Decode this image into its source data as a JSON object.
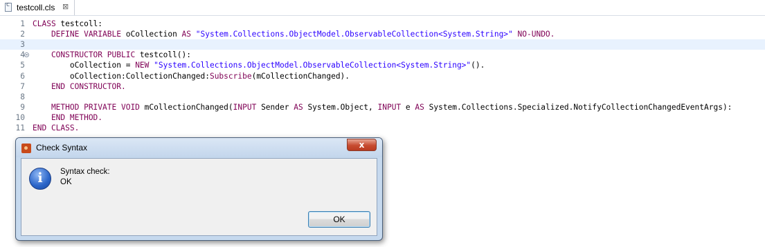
{
  "tab": {
    "filename": "testcoll.cls",
    "close_glyph": "⊠",
    "icon": "file-icon"
  },
  "editor": {
    "line_numbers": [
      "1",
      "2",
      "3",
      "4",
      "5",
      "6",
      "7",
      "8",
      "9",
      "10",
      "11"
    ],
    "lines": [
      [
        {
          "t": "CLASS ",
          "c": "kw"
        },
        {
          "t": "testcoll:",
          "c": ""
        }
      ],
      [
        {
          "t": "    DEFINE VARIABLE ",
          "c": "kw"
        },
        {
          "t": "oCollection ",
          "c": ""
        },
        {
          "t": "AS ",
          "c": "kw"
        },
        {
          "t": "\"System.Collections.ObjectModel.ObservableCollection<System.String>\"",
          "c": "str"
        },
        {
          "t": " NO-UNDO.",
          "c": "kw"
        }
      ],
      [],
      [
        {
          "t": "    CONSTRUCTOR PUBLIC ",
          "c": "kw"
        },
        {
          "t": "testcoll():",
          "c": ""
        }
      ],
      [
        {
          "t": "        oCollection = ",
          "c": ""
        },
        {
          "t": "NEW ",
          "c": "kw"
        },
        {
          "t": "\"System.Collections.ObjectModel.ObservableCollection<System.String>\"",
          "c": "str"
        },
        {
          "t": "().",
          "c": ""
        }
      ],
      [
        {
          "t": "        oCollection:CollectionChanged:",
          "c": ""
        },
        {
          "t": "Subscribe",
          "c": "kw"
        },
        {
          "t": "(mCollectionChanged).",
          "c": ""
        }
      ],
      [
        {
          "t": "    END CONSTRUCTOR.",
          "c": "kw"
        }
      ],
      [],
      [
        {
          "t": "    METHOD PRIVATE VOID ",
          "c": "kw"
        },
        {
          "t": "mCollectionChanged(",
          "c": ""
        },
        {
          "t": "INPUT ",
          "c": "kw"
        },
        {
          "t": "Sender ",
          "c": ""
        },
        {
          "t": "AS ",
          "c": "kw"
        },
        {
          "t": "System.Object, ",
          "c": ""
        },
        {
          "t": "INPUT ",
          "c": "kw"
        },
        {
          "t": "e ",
          "c": ""
        },
        {
          "t": "AS ",
          "c": "kw"
        },
        {
          "t": "System.Collections.Specialized.NotifyCollectionChangedEventArgs):",
          "c": ""
        }
      ],
      [
        {
          "t": "    END METHOD.",
          "c": "kw"
        }
      ],
      [
        {
          "t": "END CLASS.",
          "c": "kw"
        }
      ]
    ],
    "current_line": 3,
    "fold_line": 4
  },
  "dialog": {
    "title": "Check Syntax",
    "close_glyph": "x",
    "icon": "information-icon",
    "message_line1": "Syntax check:",
    "message_line2": "OK",
    "ok_label": "OK"
  },
  "colors": {
    "keyword": "#7f0055",
    "string": "#2a00ff",
    "current_line": "#e8f2fe",
    "line_number": "#6b7887"
  }
}
